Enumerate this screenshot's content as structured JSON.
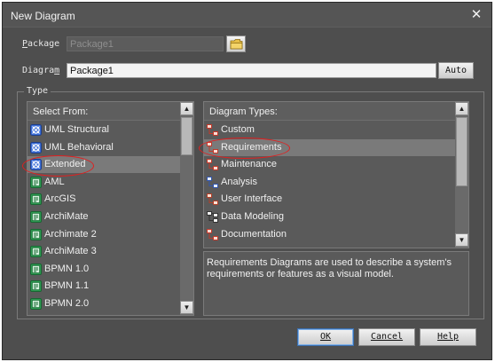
{
  "window": {
    "title": "New Diagram"
  },
  "package": {
    "label_prefix": "P",
    "label_rest": "ackage",
    "value": "Package1"
  },
  "diagram": {
    "label_prefix": "Diagra",
    "label_underline": "m",
    "value": "Package1",
    "auto_label": "Auto"
  },
  "type_group": {
    "label": "Type"
  },
  "select_from": {
    "header": "Select From:",
    "items": [
      {
        "label": "UML Structural",
        "icon": "uml-icon",
        "selected": false
      },
      {
        "label": "UML Behavioral",
        "icon": "uml-icon",
        "selected": false
      },
      {
        "label": "Extended",
        "icon": "uml-icon",
        "selected": true
      },
      {
        "label": "AML",
        "icon": "profile-icon",
        "selected": false
      },
      {
        "label": "ArcGIS",
        "icon": "profile-icon",
        "selected": false
      },
      {
        "label": "ArchiMate",
        "icon": "profile-icon",
        "selected": false
      },
      {
        "label": "Archimate 2",
        "icon": "profile-icon",
        "selected": false
      },
      {
        "label": "ArchiMate 3",
        "icon": "profile-icon",
        "selected": false
      },
      {
        "label": "BPMN 1.0",
        "icon": "profile-icon",
        "selected": false
      },
      {
        "label": "BPMN 1.1",
        "icon": "profile-icon",
        "selected": false
      },
      {
        "label": "BPMN 2.0",
        "icon": "profile-icon",
        "selected": false
      }
    ]
  },
  "diagram_types": {
    "header": "Diagram Types:",
    "items": [
      {
        "label": "Custom",
        "icon": "custom-diagram-icon",
        "selected": false
      },
      {
        "label": "Requirements",
        "icon": "requirements-diagram-icon",
        "selected": true
      },
      {
        "label": "Maintenance",
        "icon": "maintenance-diagram-icon",
        "selected": false
      },
      {
        "label": "Analysis",
        "icon": "analysis-diagram-icon",
        "selected": false
      },
      {
        "label": "User Interface",
        "icon": "user-interface-diagram-icon",
        "selected": false
      },
      {
        "label": "Data Modeling",
        "icon": "data-modeling-diagram-icon",
        "selected": false
      },
      {
        "label": "Documentation",
        "icon": "documentation-diagram-icon",
        "selected": false
      }
    ]
  },
  "description": "Requirements Diagrams are used to describe a system's requirements or features as a visual model.",
  "buttons": {
    "ok": "OK",
    "cancel": "Cancel",
    "help": "Help"
  }
}
